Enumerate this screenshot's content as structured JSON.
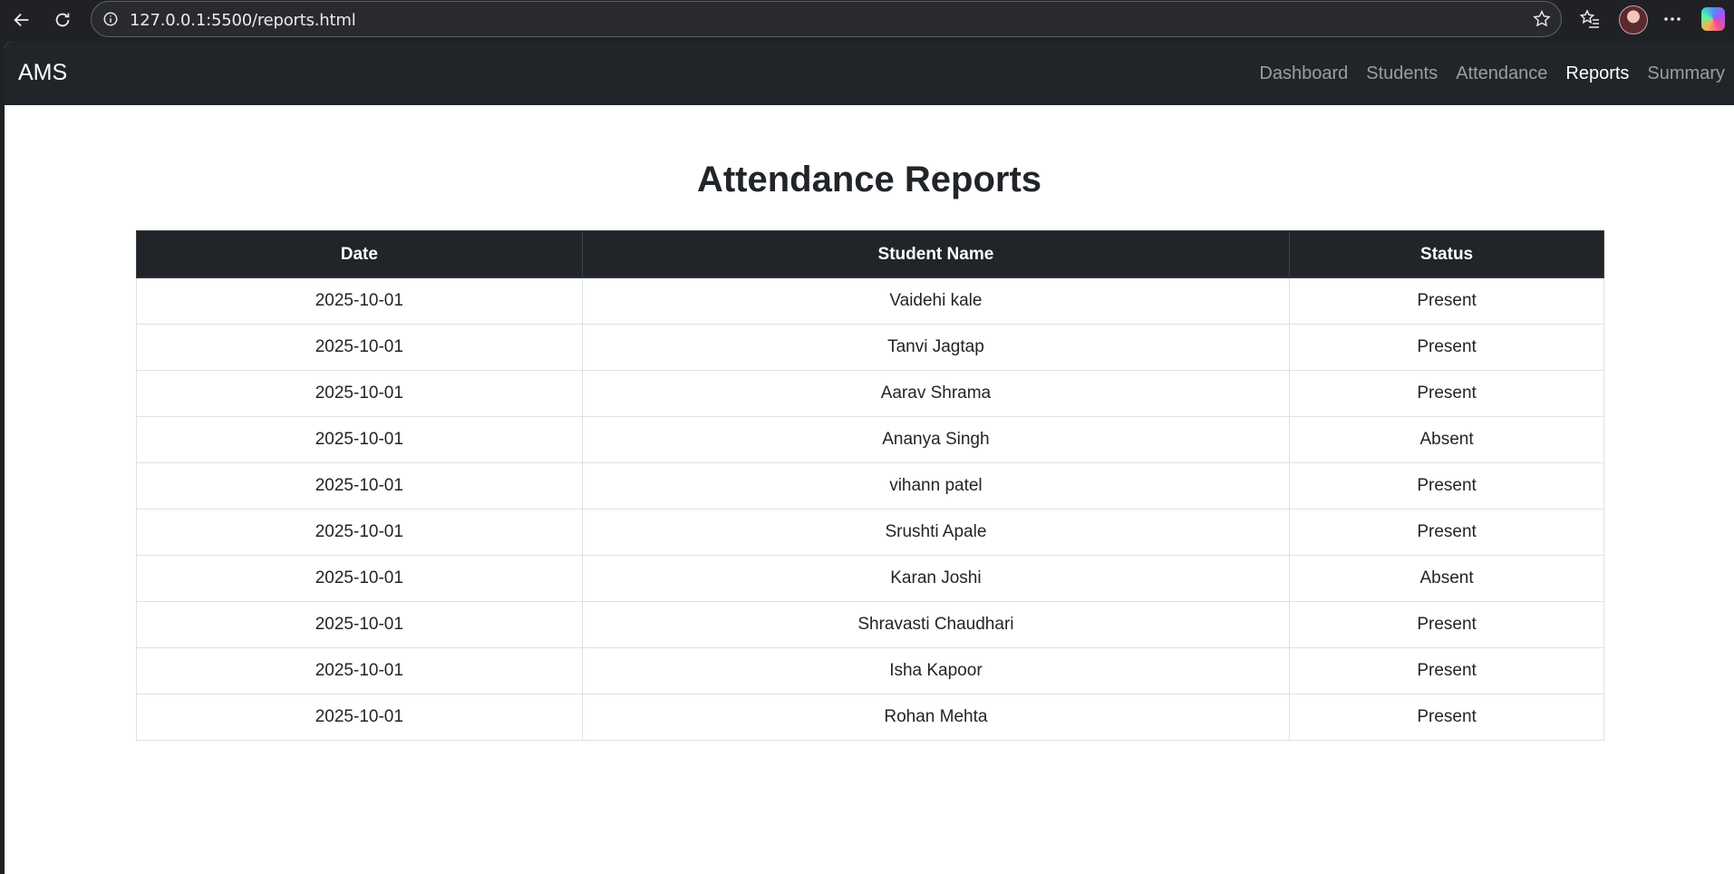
{
  "browser": {
    "url": "127.0.0.1:5500/reports.html"
  },
  "navbar": {
    "brand": "AMS",
    "links": [
      {
        "label": "Dashboard",
        "active": false
      },
      {
        "label": "Students",
        "active": false
      },
      {
        "label": "Attendance",
        "active": false
      },
      {
        "label": "Reports",
        "active": true
      },
      {
        "label": "Summary",
        "active": false
      }
    ]
  },
  "page": {
    "title": "Attendance Reports"
  },
  "table": {
    "headers": [
      "Date",
      "Student Name",
      "Status"
    ],
    "rows": [
      [
        "2025-10-01",
        "Vaidehi kale",
        "Present"
      ],
      [
        "2025-10-01",
        "Tanvi Jagtap",
        "Present"
      ],
      [
        "2025-10-01",
        "Aarav Shrama",
        "Present"
      ],
      [
        "2025-10-01",
        "Ananya Singh",
        "Absent"
      ],
      [
        "2025-10-01",
        "vihann patel",
        "Present"
      ],
      [
        "2025-10-01",
        "Srushti Apale",
        "Present"
      ],
      [
        "2025-10-01",
        "Karan Joshi",
        "Absent"
      ],
      [
        "2025-10-01",
        "Shravasti Chaudhari",
        "Present"
      ],
      [
        "2025-10-01",
        "Isha Kapoor",
        "Present"
      ],
      [
        "2025-10-01",
        "Rohan Mehta",
        "Present"
      ]
    ]
  },
  "colors": {
    "navbar_bg": "#212529",
    "header_bg": "#212529",
    "browser_bg": "#202124"
  }
}
